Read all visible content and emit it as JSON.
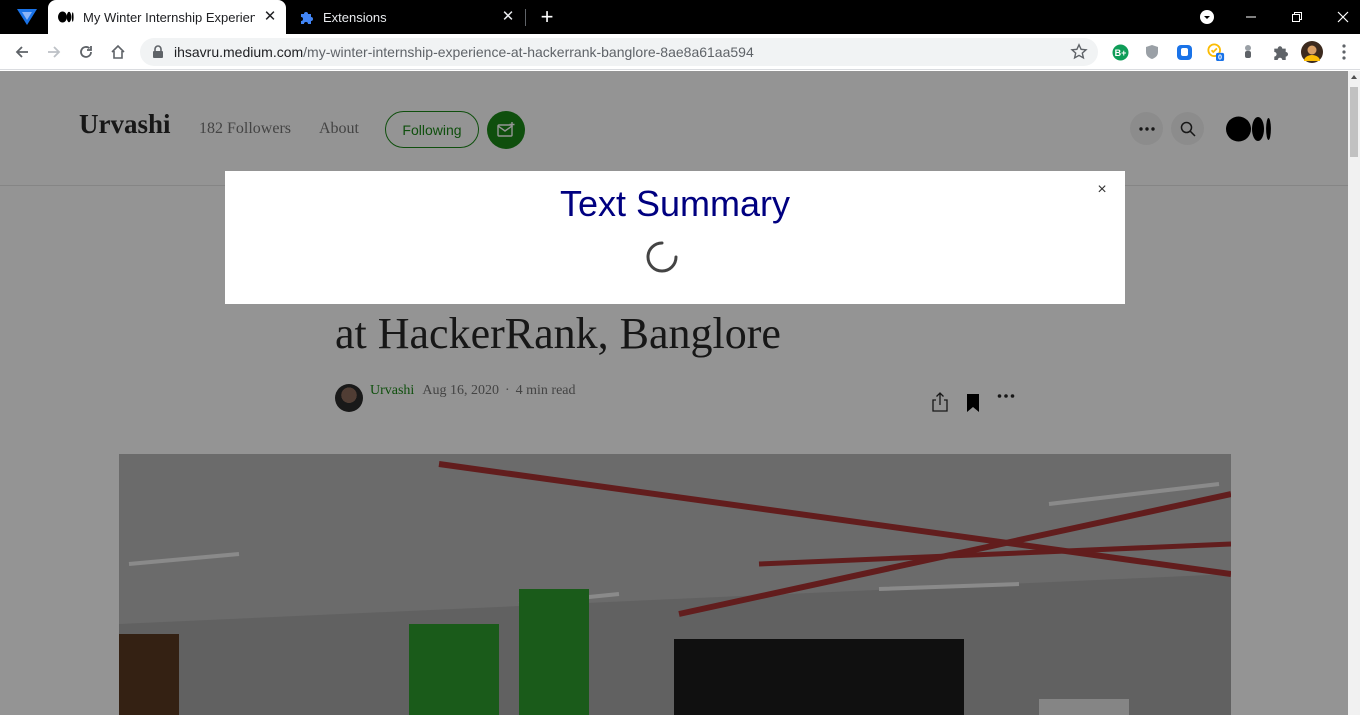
{
  "browser": {
    "tabs": [
      {
        "title": "My Winter Internship Experience",
        "active": true,
        "icon": "medium-favicon"
      },
      {
        "title": "Extensions",
        "active": false,
        "icon": "puzzle-icon"
      }
    ],
    "address": {
      "domain": "ihsavru.medium.com",
      "path": "/my-winter-internship-experience-at-hackerrank-banglore-8ae8a61aa594"
    },
    "extension_badge": "0"
  },
  "site": {
    "brand": "Urvashi",
    "followers": "182 Followers",
    "about": "About",
    "following_label": "Following"
  },
  "article": {
    "headline_line2": "at HackerRank, Banglore",
    "author": "Urvashi",
    "date": "Aug 16, 2020",
    "separator": "·",
    "read_time": "4 min read"
  },
  "modal": {
    "title": "Text Summary",
    "close_label": "×",
    "loading": true
  },
  "colors": {
    "accent_green": "#1a8917",
    "modal_title": "#000080"
  }
}
